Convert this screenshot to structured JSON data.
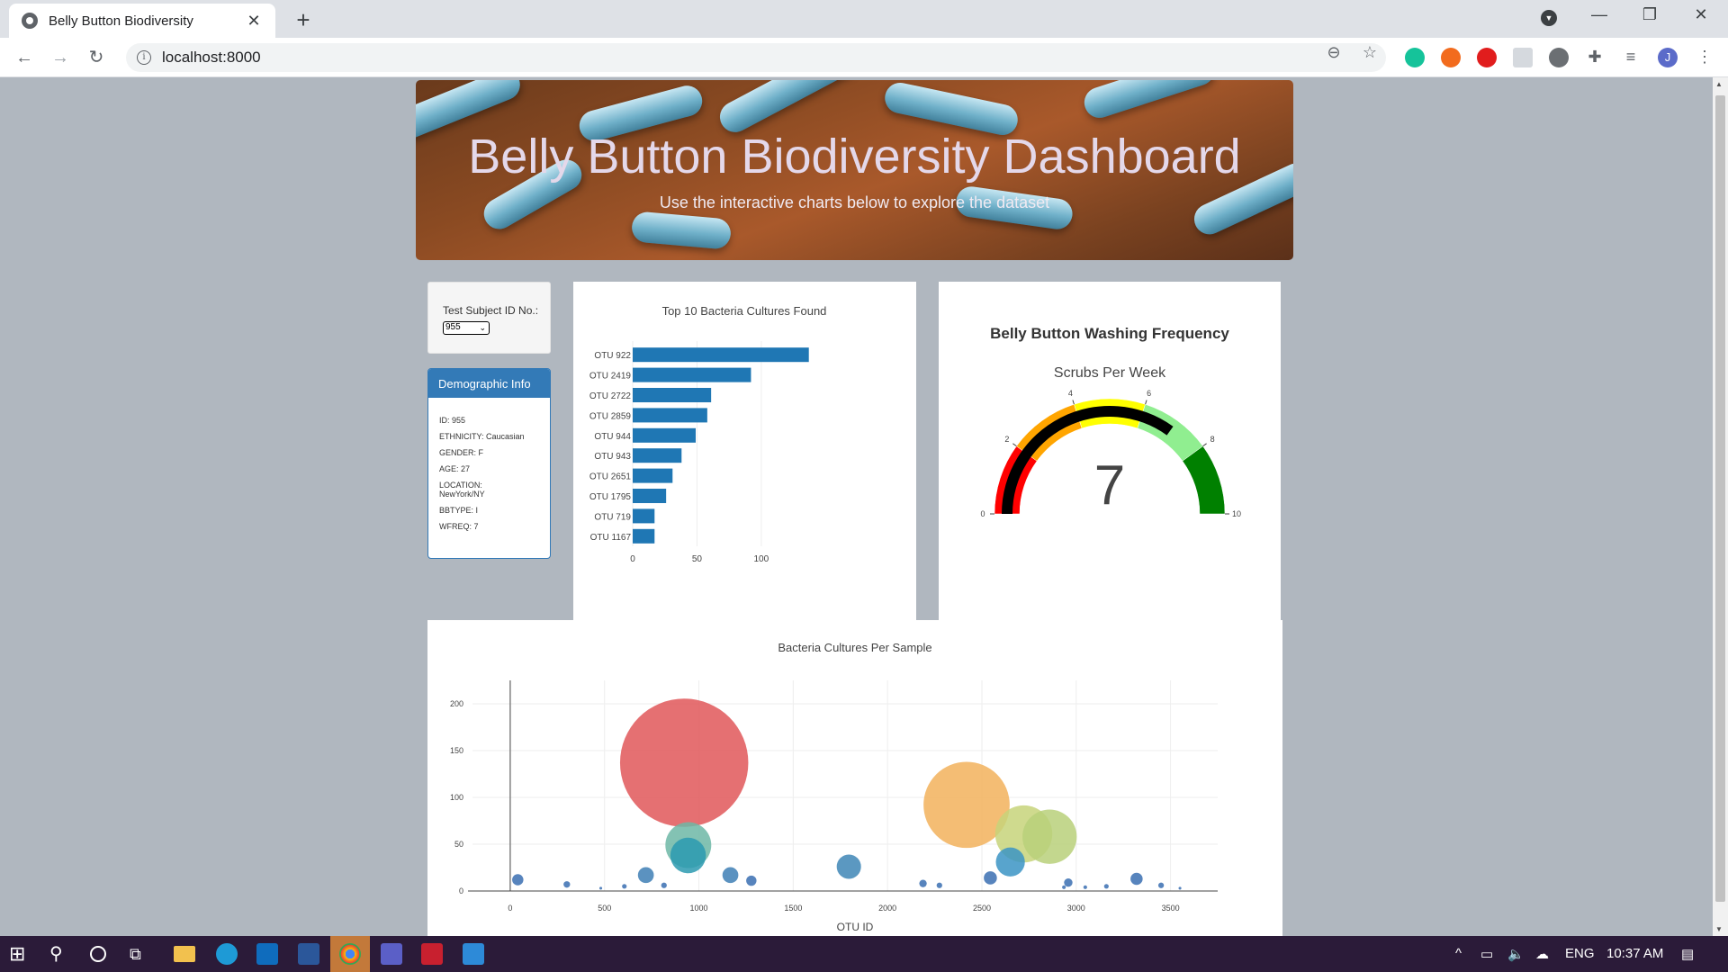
{
  "browser": {
    "tab_title": "Belly Button Biodiversity",
    "url": "localhost:8000",
    "profile_initial": "J"
  },
  "header": {
    "title": "Belly Button Biodiversity Dashboard",
    "subtitle": "Use the interactive charts below to explore the dataset"
  },
  "selector": {
    "label": "Test Subject ID No.:",
    "value": "955"
  },
  "demographics": {
    "title": "Demographic Info",
    "rows": [
      "ID: 955",
      "ETHNICITY: Caucasian",
      "GENDER: F",
      "AGE: 27",
      "LOCATION: NewYork/NY",
      "BBTYPE: I",
      "WFREQ: 7"
    ]
  },
  "colors": {
    "bar": "#1f77b4",
    "panel_header": "#337ab7",
    "gauge_bar": "#000000"
  },
  "chart_data": [
    {
      "type": "bar",
      "orientation": "horizontal",
      "title": "Top 10 Bacteria Cultures Found",
      "categories": [
        "OTU 922",
        "OTU 2419",
        "OTU 2722",
        "OTU 2859",
        "OTU 944",
        "OTU 943",
        "OTU 2651",
        "OTU 1795",
        "OTU 719",
        "OTU 1167"
      ],
      "values": [
        137,
        92,
        61,
        58,
        49,
        38,
        31,
        26,
        17,
        17
      ],
      "xticks": [
        "0",
        "50",
        "100"
      ],
      "xlim": [
        0,
        140
      ]
    },
    {
      "type": "gauge",
      "title": "Belly Button Washing Frequency",
      "subtitle": "Scrubs Per Week",
      "value": 7,
      "display_value": "7",
      "range": [
        0,
        10
      ],
      "ticks": [
        "0",
        "2",
        "4",
        "6",
        "8",
        "10"
      ],
      "steps": [
        {
          "range": [
            0,
            2
          ],
          "color": "#ff0000"
        },
        {
          "range": [
            2,
            4
          ],
          "color": "#ffa500"
        },
        {
          "range": [
            4,
            6
          ],
          "color": "#ffff00"
        },
        {
          "range": [
            6,
            8
          ],
          "color": "#90ee90"
        },
        {
          "range": [
            8,
            10
          ],
          "color": "#008000"
        }
      ]
    },
    {
      "type": "scatter",
      "mode": "bubble",
      "title": "Bacteria Cultures Per Sample",
      "xlabel": "OTU ID",
      "xticks": [
        "0",
        "500",
        "1000",
        "1500",
        "2000",
        "2500",
        "3000",
        "3500"
      ],
      "yticks": [
        "0",
        "50",
        "100",
        "150",
        "200"
      ],
      "xlim": [
        -200,
        3750
      ],
      "ylim": [
        0,
        225
      ],
      "points": [
        {
          "x": 922,
          "y": 137,
          "color": "#e15759"
        },
        {
          "x": 2419,
          "y": 92,
          "color": "#f2b25c"
        },
        {
          "x": 2722,
          "y": 61,
          "color": "#c7d47a"
        },
        {
          "x": 2859,
          "y": 58,
          "color": "#b8d07a"
        },
        {
          "x": 944,
          "y": 49,
          "color": "#6db7a6"
        },
        {
          "x": 943,
          "y": 38,
          "color": "#2c9ab0"
        },
        {
          "x": 2651,
          "y": 31,
          "color": "#3b94c4"
        },
        {
          "x": 1795,
          "y": 26,
          "color": "#3e86b6"
        },
        {
          "x": 719,
          "y": 17,
          "color": "#3e7fb5"
        },
        {
          "x": 1167,
          "y": 17,
          "color": "#3e7fb5"
        },
        {
          "x": 40,
          "y": 12,
          "color": "#3a6fb2"
        },
        {
          "x": 1278,
          "y": 11,
          "color": "#3a6fb2"
        },
        {
          "x": 2545,
          "y": 14,
          "color": "#3a6fb2"
        },
        {
          "x": 3320,
          "y": 13,
          "color": "#3a6fb2"
        },
        {
          "x": 2958,
          "y": 9,
          "color": "#3a6fb2"
        },
        {
          "x": 2188,
          "y": 8,
          "color": "#3a6fb2"
        },
        {
          "x": 300,
          "y": 7,
          "color": "#3a6fb2"
        },
        {
          "x": 2275,
          "y": 6,
          "color": "#3a6fb2"
        },
        {
          "x": 3450,
          "y": 6,
          "color": "#3a6fb2"
        },
        {
          "x": 815,
          "y": 6,
          "color": "#3a6fb2"
        },
        {
          "x": 605,
          "y": 5,
          "color": "#3a6fb2"
        },
        {
          "x": 3160,
          "y": 5,
          "color": "#3a6fb2"
        },
        {
          "x": 2935,
          "y": 4,
          "color": "#3a6fb2"
        },
        {
          "x": 3048,
          "y": 4,
          "color": "#3a6fb2"
        },
        {
          "x": 480,
          "y": 3,
          "color": "#3a6fb2"
        },
        {
          "x": 3550,
          "y": 3,
          "color": "#3a6fb2"
        }
      ]
    }
  ],
  "taskbar": {
    "language": "ENG",
    "time": "10:37 AM"
  }
}
